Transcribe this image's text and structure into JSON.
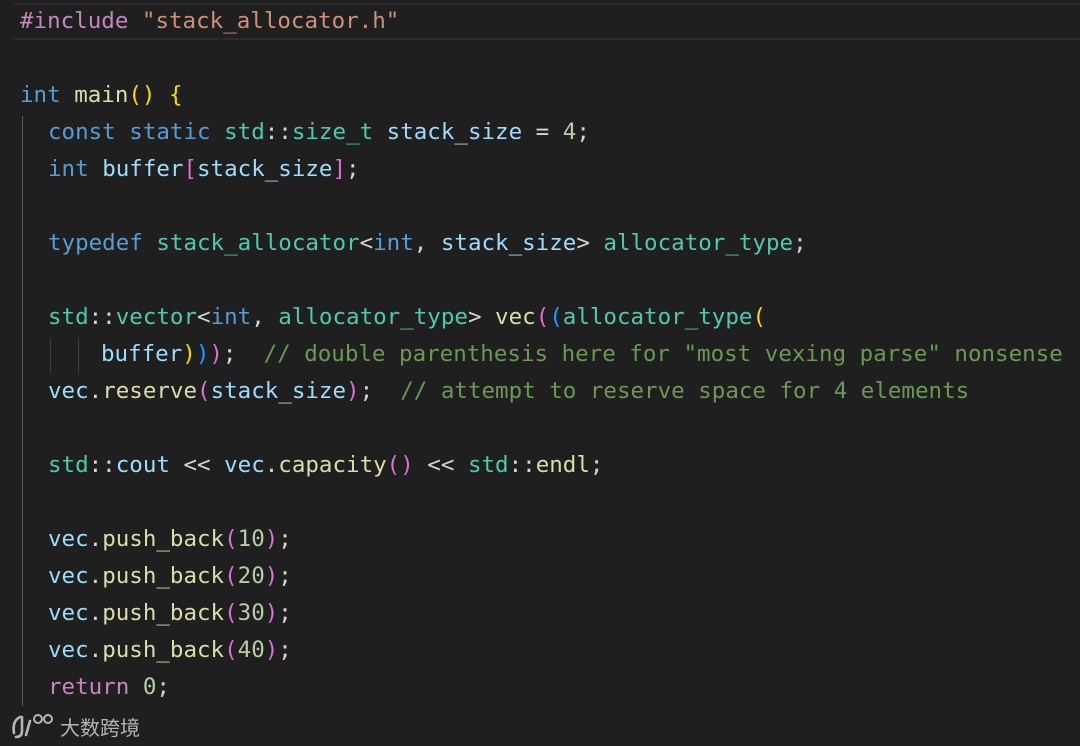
{
  "editor": {
    "lines": {
      "l1": {
        "kw_include": "#include",
        "sp1": " ",
        "path": "\"stack_allocator.h\""
      },
      "l3": {
        "kw_int": "int",
        "sp1": " ",
        "fn_main": "main",
        "paren_open": "(",
        "paren_close": ")",
        "sp2": " ",
        "brace": "{"
      },
      "l4": {
        "kw_const": "const",
        "sp1": " ",
        "kw_static": "static",
        "sp2": " ",
        "ns": "std",
        "sep": "::",
        "type": "size_t",
        "sp3": " ",
        "var": "stack_size",
        "assign": " = ",
        "num": "4",
        "semi": ";"
      },
      "l5": {
        "kw_int": "int",
        "sp1": " ",
        "var": "buffer",
        "br_open": "[",
        "idx": "stack_size",
        "br_close": "]",
        "semi": ";"
      },
      "l7": {
        "kw_typedef": "typedef",
        "sp1": " ",
        "type": "stack_allocator",
        "lt": "<",
        "kw_int": "int",
        "comma": ", ",
        "param": "stack_size",
        "gt": ">",
        "sp2": " ",
        "alias": "allocator_type",
        "semi": ";"
      },
      "l9": {
        "ns": "std",
        "sep": "::",
        "type": "vector",
        "lt": "<",
        "kw_int": "int",
        "comma": ", ",
        "alloc": "allocator_type",
        "gt": ">",
        "sp1": " ",
        "var": "vec",
        "p1": "(",
        "p2": "(",
        "ctor": "allocator_type",
        "p3": "("
      },
      "l10": {
        "arg": "buffer",
        "p3c": ")",
        "p2c": ")",
        "p1c": ")",
        "semi": ";",
        "gap": "  ",
        "comment": "// double parenthesis here for \"most vexing parse\" nonsense"
      },
      "l11": {
        "obj": "vec",
        "dot": ".",
        "method": "reserve",
        "p_open": "(",
        "arg": "stack_size",
        "p_close": ")",
        "semi": ";",
        "gap": "  ",
        "comment": "// attempt to reserve space for 4 elements"
      },
      "l13": {
        "ns": "std",
        "sep": "::",
        "cout": "cout",
        "shl1": " << ",
        "obj": "vec",
        "dot": ".",
        "method": "capacity",
        "p_open": "(",
        "p_close": ")",
        "shl2": " << ",
        "ns2": "std",
        "sep2": "::",
        "endl": "endl",
        "semi": ";"
      },
      "l15": {
        "obj": "vec",
        "dot": ".",
        "method": "push_back",
        "p_open": "(",
        "num": "10",
        "p_close": ")",
        "semi": ";"
      },
      "l16": {
        "obj": "vec",
        "dot": ".",
        "method": "push_back",
        "p_open": "(",
        "num": "20",
        "p_close": ")",
        "semi": ";"
      },
      "l17": {
        "obj": "vec",
        "dot": ".",
        "method": "push_back",
        "p_open": "(",
        "num": "30",
        "p_close": ")",
        "semi": ";"
      },
      "l18": {
        "obj": "vec",
        "dot": ".",
        "method": "push_back",
        "p_open": "(",
        "num": "40",
        "p_close": ")",
        "semi": ";"
      },
      "l19": {
        "kw_return": "return",
        "sp1": " ",
        "num": "0",
        "semi": ";"
      }
    }
  },
  "watermark": {
    "text": "大数跨境"
  },
  "colors": {
    "background": "#1f1f1f",
    "keyword": "#569cd6",
    "control": "#c586c0",
    "type": "#4ec9b0",
    "function": "#dcdcaa",
    "variable": "#9cdcfe",
    "string": "#ce9178",
    "number": "#b5cea8",
    "comment": "#6a9955"
  }
}
